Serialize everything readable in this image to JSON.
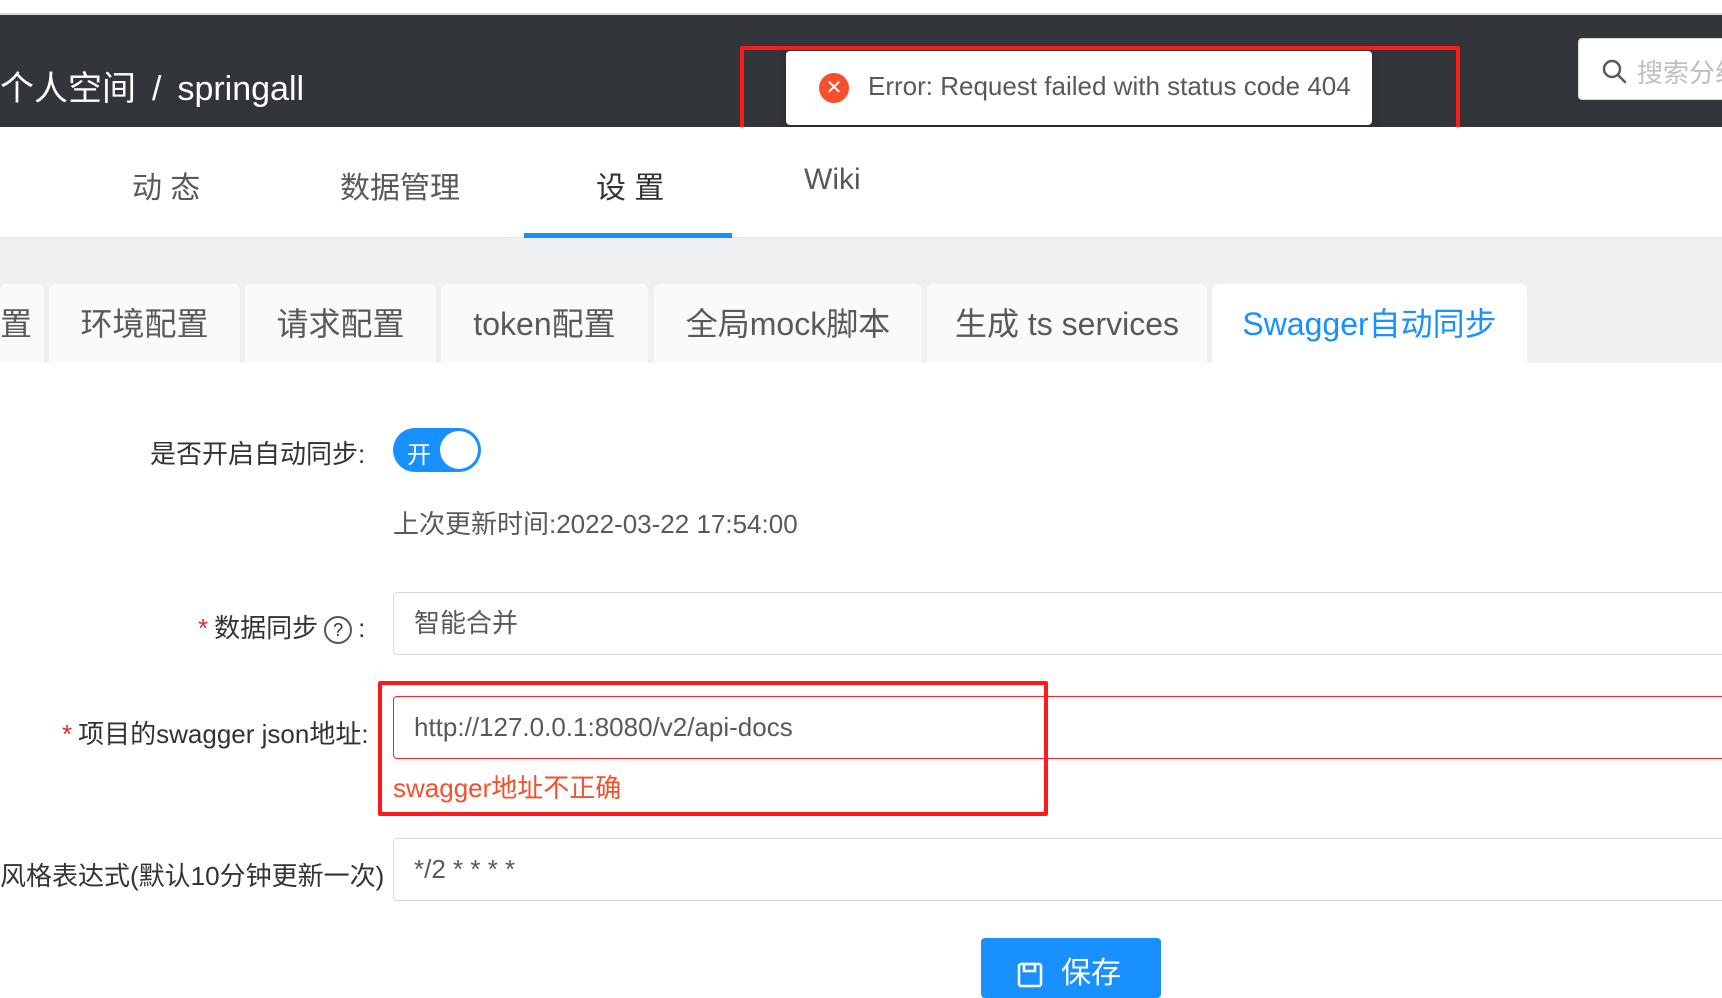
{
  "header": {
    "breadcrumb_space": "个人空间",
    "breadcrumb_sep": "/",
    "breadcrumb_project": "springall",
    "search_placeholder": "搜索分组"
  },
  "toast": {
    "message": "Error: Request failed with status code 404",
    "icon": "close-circle-icon",
    "color": "#f5502c"
  },
  "nav": {
    "tabs": [
      "动 态",
      "数据管理",
      "设 置",
      "Wiki"
    ],
    "active_index": 2
  },
  "subtabs": {
    "items": [
      "置",
      "环境配置",
      "请求配置",
      "token配置",
      "全局mock脚本",
      "生成 ts services",
      "Swagger自动同步"
    ],
    "active_index": 6
  },
  "form": {
    "auto_sync_label": "是否开启自动同步:",
    "auto_sync_switch_text": "开",
    "auto_sync_on": true,
    "last_update": "上次更新时间:2022-03-22 17:54:00",
    "data_sync_label": "数据同步",
    "data_sync_value": "智能合并",
    "swagger_label": "项目的swagger json地址:",
    "swagger_value": "http://127.0.0.1:8080/v2/api-docs",
    "swagger_error": "swagger地址不正确",
    "cron_label": "风格表达式(默认10分钟更新一次)",
    "cron_value": "*/2 * * * *",
    "save_label": "保存"
  },
  "colors": {
    "header_bg": "#32363a",
    "accent": "#1890ff",
    "error": "#f5222d",
    "annotation_box": "#ff1a1a"
  }
}
